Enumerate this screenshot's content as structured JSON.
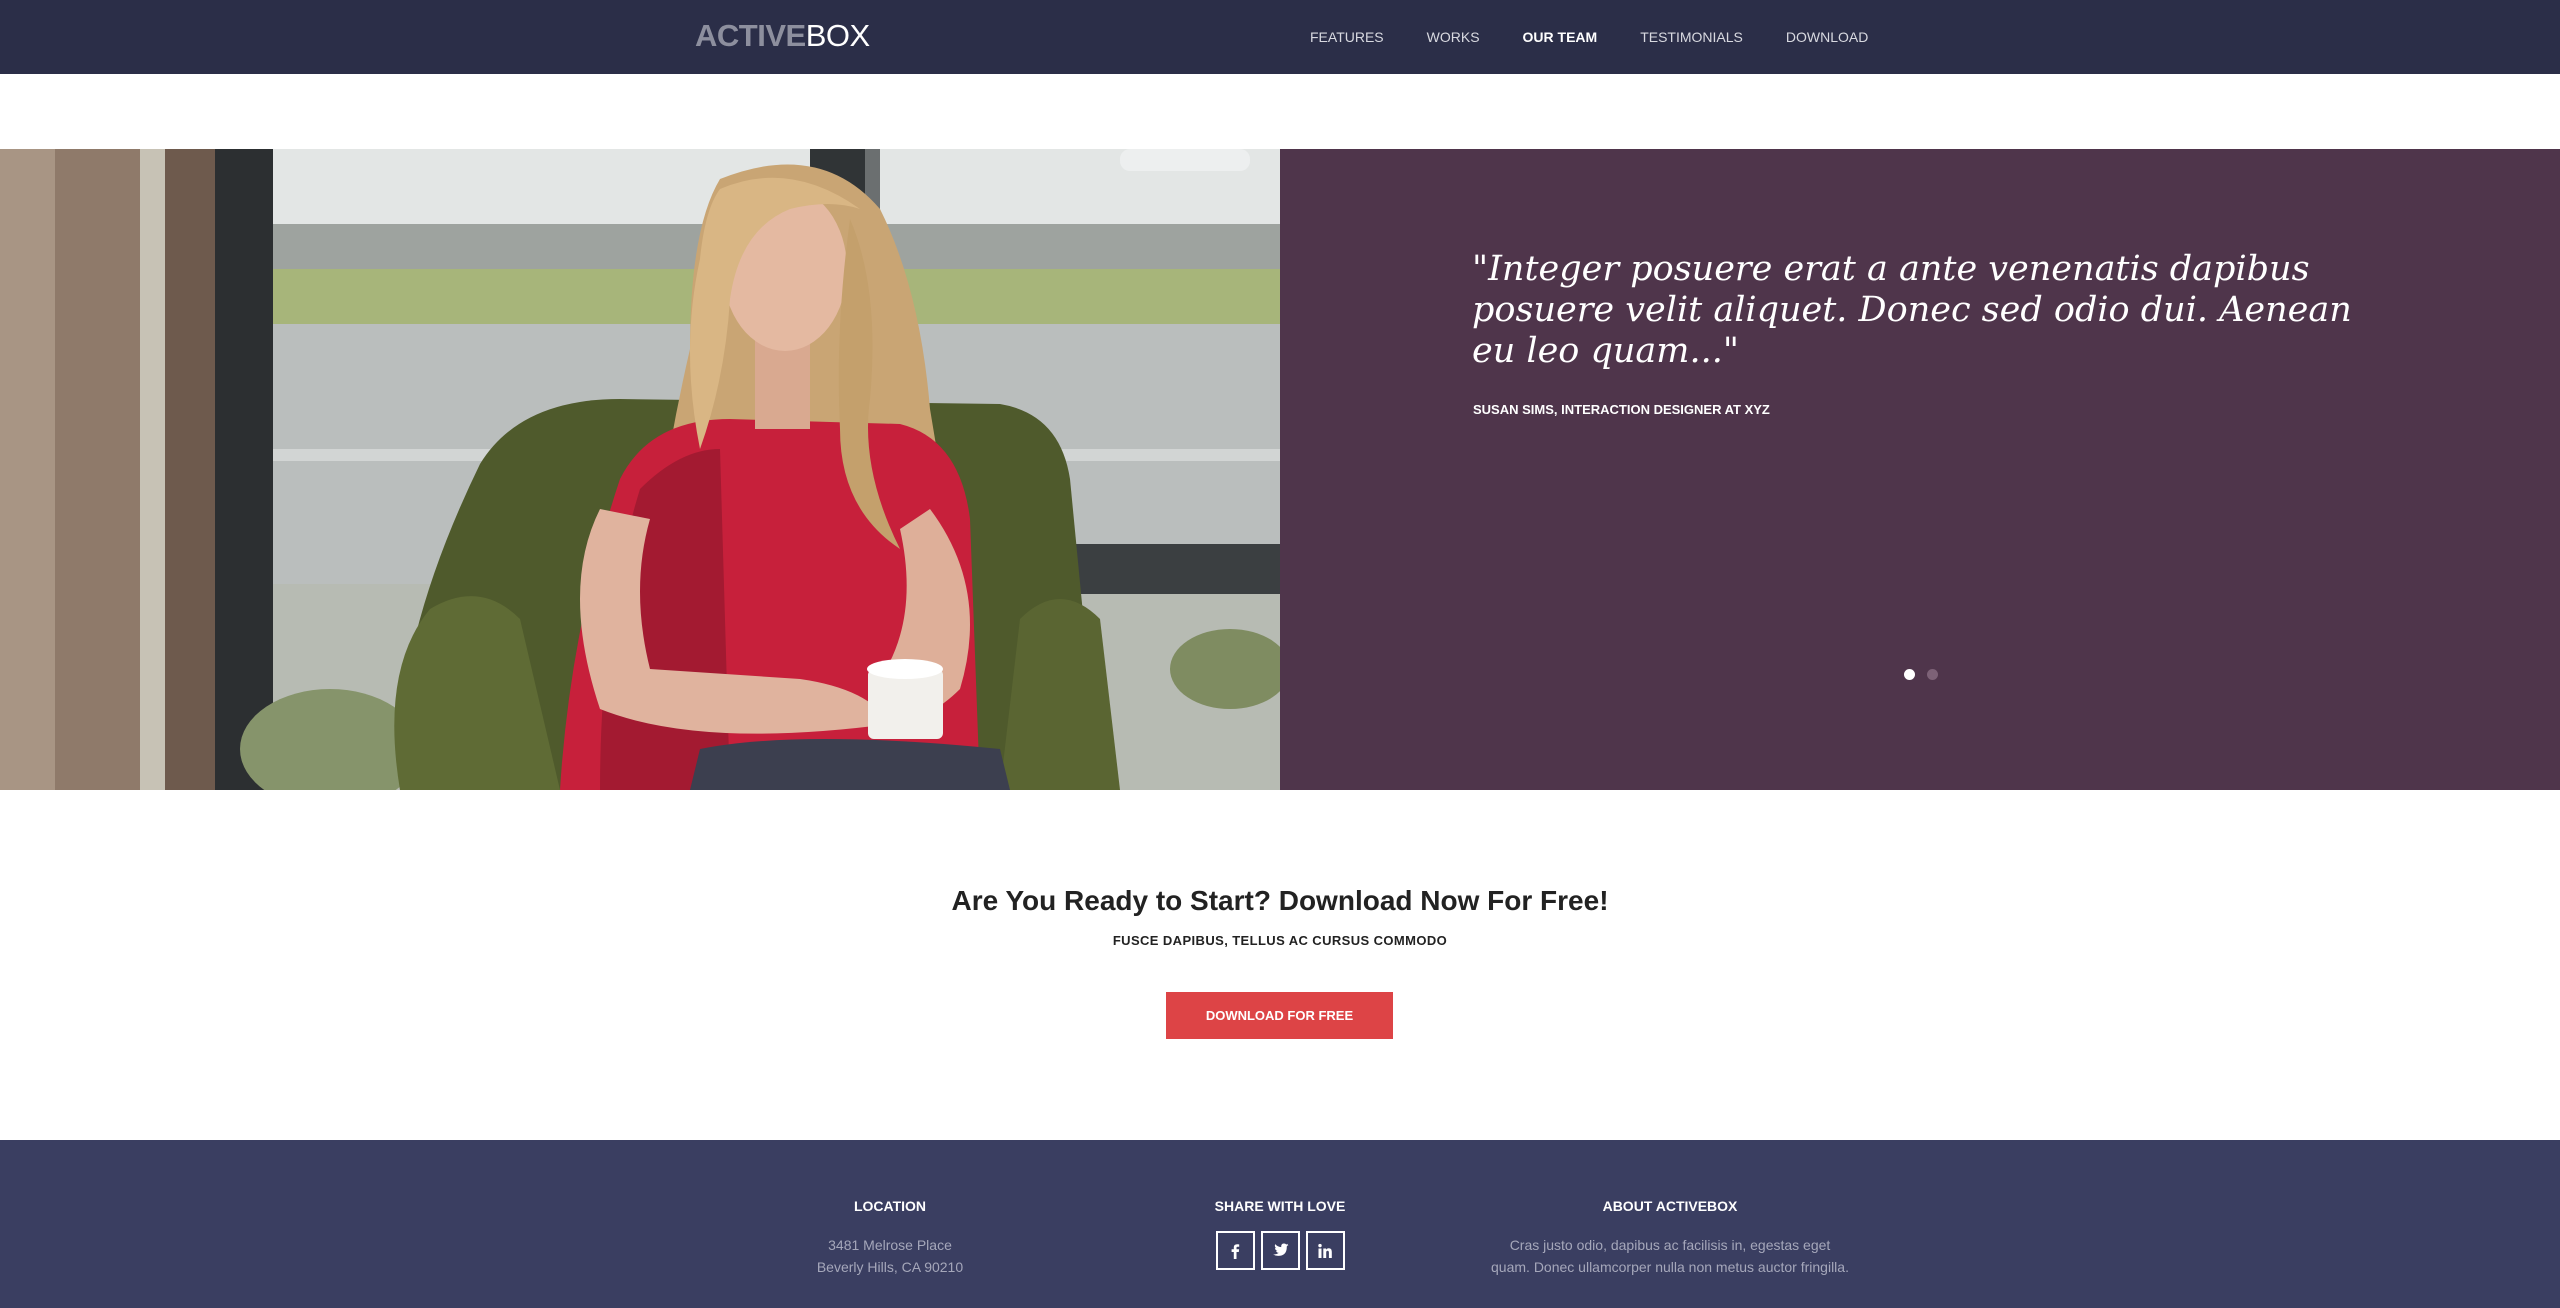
{
  "header": {
    "logo_bold": "ACTIVE",
    "logo_light": "BOX",
    "nav": [
      {
        "label": "FEATURES",
        "active": false
      },
      {
        "label": "WORKS",
        "active": false
      },
      {
        "label": "OUR TEAM",
        "active": true
      },
      {
        "label": "TESTIMONIALS",
        "active": false
      },
      {
        "label": "DOWNLOAD",
        "active": false
      }
    ]
  },
  "testimonial": {
    "quote": "\"Integer posuere erat a ante venenatis dapibus posuere velit aliquet. Donec sed odio dui. Aenean eu leo quam...\"",
    "author": "SUSAN SIMS, INTERACTION DESIGNER AT XYZ",
    "slide_count": 2,
    "active_slide": 1
  },
  "cta": {
    "title": "Are You Ready to Start? Download Now For Free!",
    "subtitle": "FUSCE DAPIBUS, TELLUS AC CURSUS COMMODO",
    "button_label": "DOWNLOAD FOR FREE"
  },
  "footer": {
    "location": {
      "heading": "LOCATION",
      "line1": "3481 Melrose Place",
      "line2": "Beverly Hills, CA 90210"
    },
    "share": {
      "heading": "SHARE WITH LOVE",
      "icons": [
        "facebook-icon",
        "twitter-icon",
        "linkedin-icon"
      ]
    },
    "about": {
      "heading": "ABOUT ACTIVEBOX",
      "line1": "Cras justo odio, dapibus ac facilisis in, egestas eget",
      "line2": "quam. Donec ullamcorper nulla non metus auctor fringilla."
    }
  },
  "colors": {
    "navbar": "#2b2e48",
    "quote_panel": "#4f354b",
    "cta_button": "#dd4446",
    "footer": "#3a3e61"
  }
}
